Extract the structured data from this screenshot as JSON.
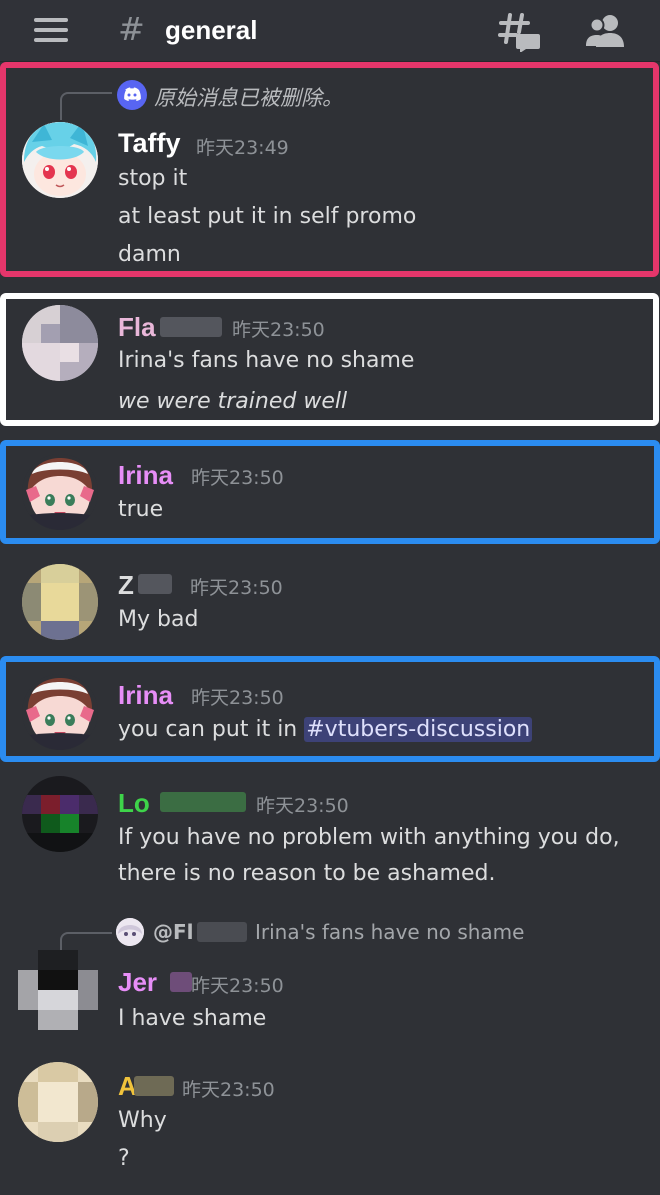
{
  "header": {
    "menu_icon": "hamburger-menu-icon",
    "hash": "#",
    "channel": "general",
    "threads_icon": "threads-icon",
    "members_icon": "members-icon"
  },
  "colors": {
    "highlight_red": "#e5366b",
    "highlight_white": "#ffffff",
    "highlight_blue": "#2b8cf0",
    "irina": "#e78ef7",
    "lo_green": "#3ed44a",
    "a_yellow": "#f0c33c",
    "mention_bg": "#4b5296"
  },
  "messages": [
    {
      "reply_deleted": "原始消息已被删除。",
      "author": "Taffy",
      "time": "昨天23:49",
      "lines": [
        "stop it",
        "at least put it in self promo",
        "damn"
      ]
    },
    {
      "author": "Fla",
      "time": "昨天23:50",
      "lines": [
        "Irina's fans have no shame",
        "we were trained well"
      ]
    },
    {
      "author": "Irina",
      "time": "昨天23:50",
      "lines": [
        "true"
      ]
    },
    {
      "author": "Z",
      "time": "昨天23:50",
      "lines": [
        "My bad"
      ]
    },
    {
      "author": "Irina",
      "time": "昨天23:50",
      "text_prefix": "you can put it in ",
      "channel_mention": "#vtubers-discussion"
    },
    {
      "author": "Lo",
      "time": "昨天23:50",
      "lines": [
        "If you have no problem with anything you do,",
        "there is no reason to be ashamed."
      ]
    },
    {
      "reply_author": "@Fl",
      "reply_text": "Irina's fans have no shame",
      "author": "Jer",
      "time": "昨天23:50",
      "lines": [
        "I have shame"
      ]
    },
    {
      "author": "A",
      "time": "昨天23:50",
      "lines": [
        "Why",
        "?"
      ]
    }
  ]
}
